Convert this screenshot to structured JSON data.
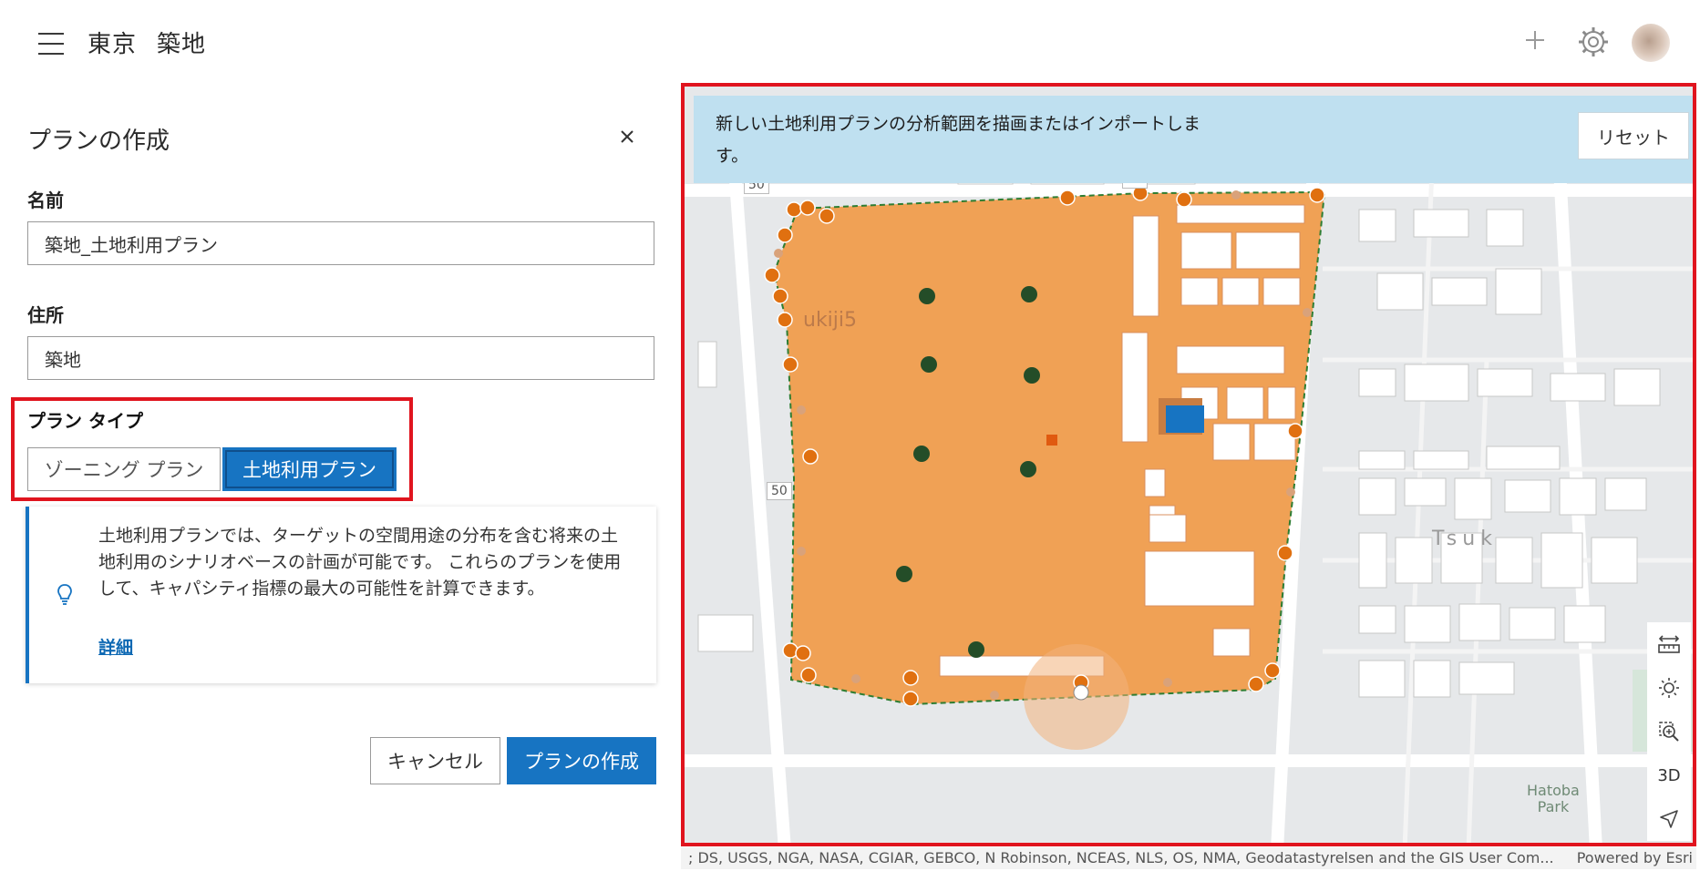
{
  "header": {
    "title_parts": [
      "東京",
      "築地"
    ]
  },
  "panel": {
    "title": "プランの作成",
    "name_label": "名前",
    "name_value": "築地_土地利用プラン",
    "address_label": "住所",
    "address_value": "築地",
    "plan_type_label": "プラン タイプ",
    "plan_types": [
      "ゾーニング プラン",
      "土地利用プラン"
    ],
    "selected_plan_type": "土地利用プラン",
    "info_text": "土地利用プランでは、ターゲットの空間用途の分布を含む将来の土地利用のシナリオベースの計画が可能です。 これらのプランを使用して、キャパシティ指標の最大の可能性を計算できます。",
    "info_link": "詳細",
    "cancel_label": "キャンセル",
    "create_label": "プランの作成"
  },
  "map": {
    "banner_text": "新しい土地利用プランの分析範囲を描画またはインポートします。",
    "reset_label": "リセット",
    "road_labels": [
      "50",
      "50",
      "50"
    ],
    "place_labels": [
      "ukiji5",
      "Tsuk",
      "Hatoba",
      "Park"
    ],
    "tools": [
      "measure-icon",
      "sun-icon",
      "zoom-area-icon",
      "3D",
      "locate-icon"
    ],
    "tool_3d_label": "3D",
    "attribution": "; DS, USGS, NGA, NASA, CGIAR, GEBCO, N Robinson, NCEAS, NLS, OS, NMA, Geodatastyrelsen and the GIS User Com...",
    "powered_by": "Powered by Esri",
    "colors": {
      "plan_area": "#f0a155",
      "vertex": "#e07010",
      "building": "#ffffff",
      "highlight": "#1774c2",
      "banner": "#bfe0f0"
    }
  }
}
